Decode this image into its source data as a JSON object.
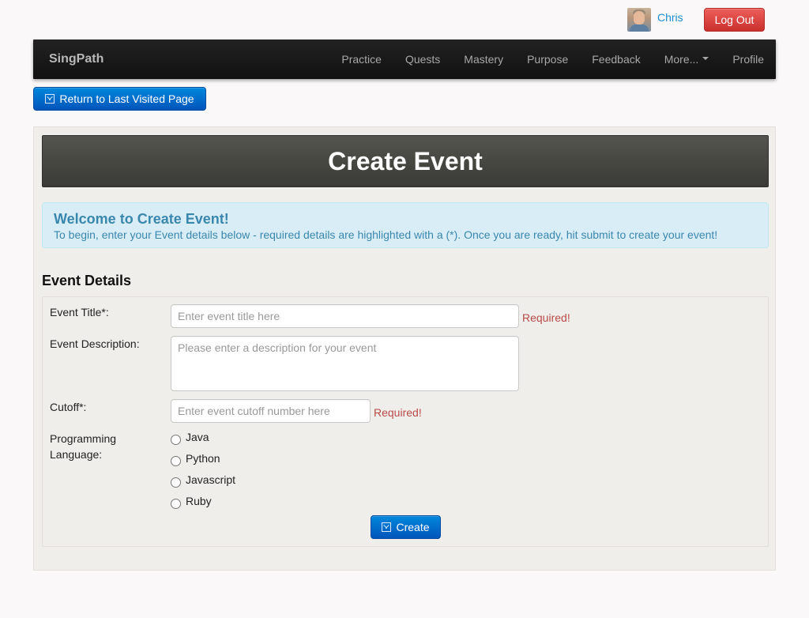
{
  "user": {
    "name": "Chris",
    "logout_label": "Log Out"
  },
  "navbar": {
    "brand": "SingPath",
    "items": [
      {
        "label": "Practice"
      },
      {
        "label": "Quests"
      },
      {
        "label": "Mastery"
      },
      {
        "label": "Purpose"
      },
      {
        "label": "Feedback"
      },
      {
        "label": "More..."
      },
      {
        "label": "Profile"
      }
    ]
  },
  "return_button": {
    "label": "Return to Last Visited Page"
  },
  "page": {
    "title": "Create Event",
    "alert_title": "Welcome to Create Event!",
    "alert_text": "To begin, enter your Event details below - required details are highlighted with a (*). Once you are ready, hit submit to create your event!"
  },
  "form": {
    "section_title": "Event Details",
    "title_label": "Event Title*:",
    "title_placeholder": "Enter event title here",
    "title_required": "Required!",
    "description_label": "Event Description:",
    "description_placeholder": "Please enter a description for your event",
    "cutoff_label": "Cutoff*:",
    "cutoff_placeholder": "Enter event cutoff number here",
    "cutoff_required": "Required!",
    "language_label_line1": "Programming",
    "language_label_line2": "Language:",
    "languages": [
      {
        "label": "Java"
      },
      {
        "label": "Python"
      },
      {
        "label": "Javascript"
      },
      {
        "label": "Ruby"
      }
    ],
    "submit_label": "Create"
  },
  "colors": {
    "primary": "#0070cc",
    "danger": "#da4f49",
    "alert_bg": "#d9edf7",
    "alert_text": "#3a87ad",
    "navbar_bg": "#1b1b1b"
  }
}
